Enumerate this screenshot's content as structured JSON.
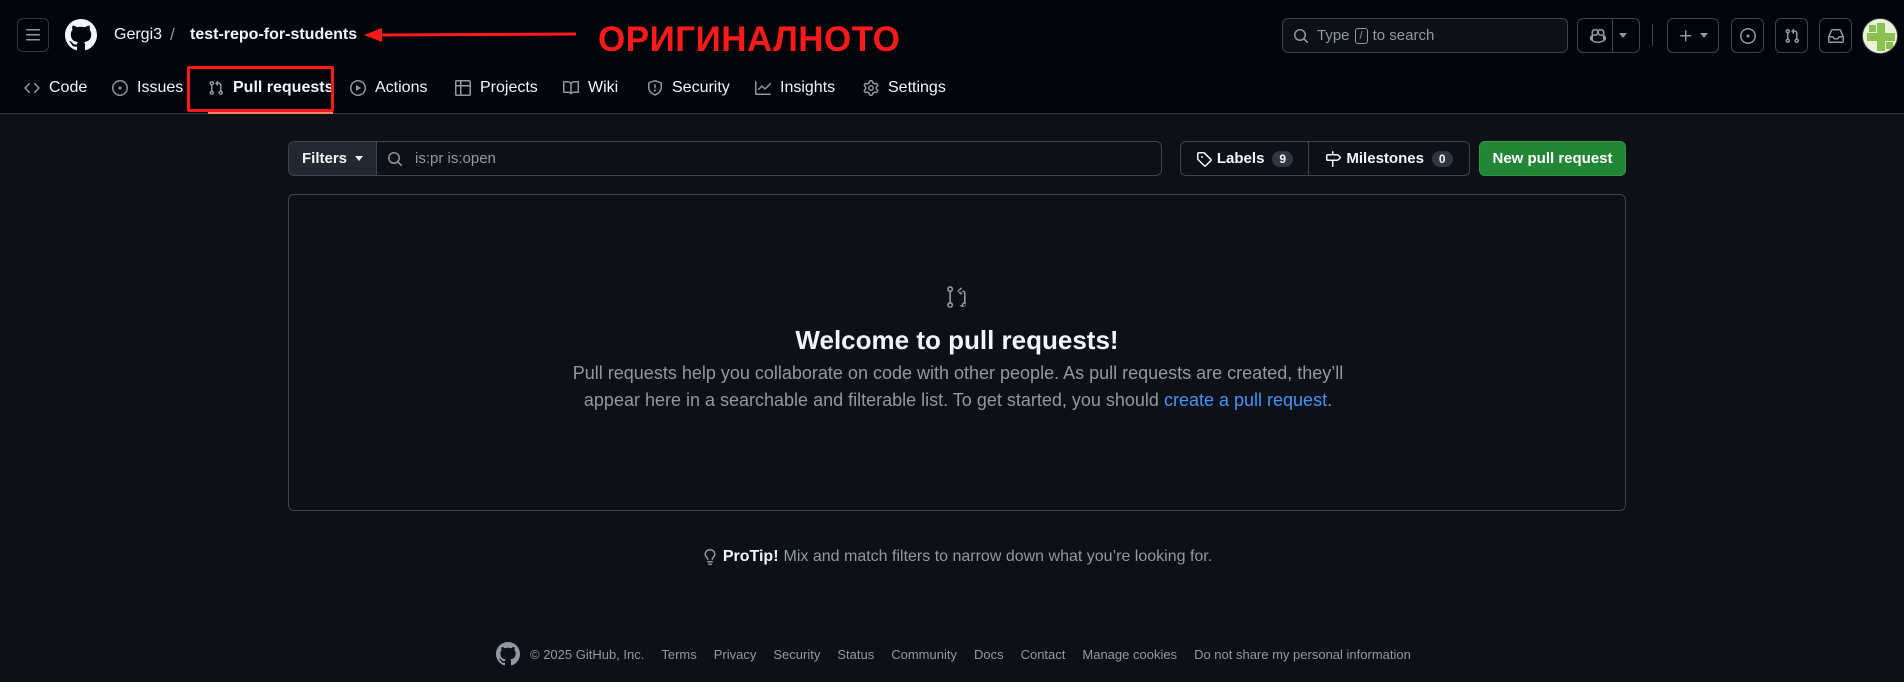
{
  "header": {
    "owner": "Gergi3",
    "separator": "/",
    "repo": "test-repo-for-students",
    "search": {
      "prefix": "Type",
      "key": "/",
      "suffix": "to search"
    }
  },
  "annotation": {
    "text": "ОРИГИНАЛНОТО",
    "color": "#ff1a1a"
  },
  "repo_nav": {
    "items": [
      {
        "label": "Code",
        "icon": "code-icon"
      },
      {
        "label": "Issues",
        "icon": "issue-opened-icon"
      },
      {
        "label": "Pull requests",
        "icon": "git-pull-request-icon",
        "active": true
      },
      {
        "label": "Actions",
        "icon": "play-icon"
      },
      {
        "label": "Projects",
        "icon": "table-icon"
      },
      {
        "label": "Wiki",
        "icon": "book-icon"
      },
      {
        "label": "Security",
        "icon": "shield-icon"
      },
      {
        "label": "Insights",
        "icon": "graph-icon"
      },
      {
        "label": "Settings",
        "icon": "gear-icon"
      }
    ]
  },
  "toolbar": {
    "filters_label": "Filters",
    "search_value": "is:pr is:open",
    "labels_label": "Labels",
    "labels_count": "9",
    "milestones_label": "Milestones",
    "milestones_count": "0",
    "new_pr_label": "New pull request"
  },
  "blankslate": {
    "title": "Welcome to pull requests!",
    "desc_line1": "Pull requests help you collaborate on code with other people. As pull requests are created, they’ll",
    "desc_line2": "appear here in a searchable and filterable list. To get started, you should",
    "link": "create a pull request",
    "desc_end": "."
  },
  "protip": {
    "label": "ProTip!",
    "text": "Mix and match filters to narrow down what you’re looking for."
  },
  "footer": {
    "copyright": "© 2025 GitHub, Inc.",
    "links": [
      "Terms",
      "Privacy",
      "Security",
      "Status",
      "Community",
      "Docs",
      "Contact",
      "Manage cookies",
      "Do not share my personal information"
    ]
  },
  "colors": {
    "background": "#0d1117",
    "header_bg": "#010409",
    "accent_blue": "#4493f8",
    "primary_green": "#238636",
    "active_underline": "#f78166"
  }
}
